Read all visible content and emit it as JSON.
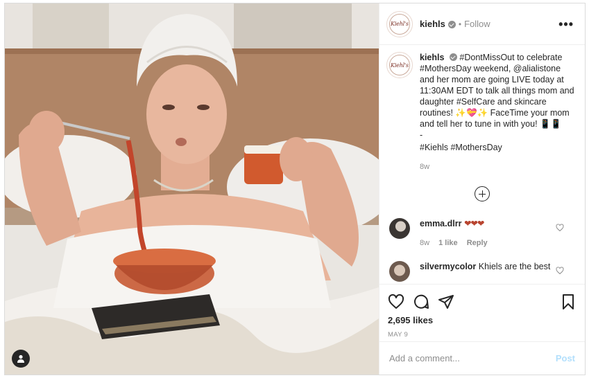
{
  "post": {
    "username": "kiehls",
    "follow_label": "Follow",
    "more_label": "•••",
    "logo_text": "Kiehl's",
    "caption": {
      "username": "kiehls",
      "text": "#DontMissOut to celebrate #MothersDay weekend, @alialistone and her mom are going LIVE today at 11:30AM EDT to talk all things mom and daughter #SelfCare and skincare routines! ✨💝✨ FaceTime your mom and tell her to tune in with you! 📱📱\n-",
      "hashtags": "#Kiehls #MothersDay",
      "age": "8w"
    },
    "comments": [
      {
        "username": "emma.dlrr",
        "text": "❤❤❤",
        "age": "8w",
        "likes": "1 like",
        "reply_label": "Reply"
      },
      {
        "username": "silvermycolor",
        "text": "Khiels are the best",
        "age": "",
        "likes": "",
        "reply_label": ""
      }
    ],
    "likes": "2,695 likes",
    "date": "MAY 9",
    "add_comment_placeholder": "Add a comment...",
    "post_label": "Post"
  },
  "icons": {
    "like": "heart-icon",
    "comment": "comment-bubble-icon",
    "share": "paper-plane-icon",
    "save": "bookmark-icon",
    "user_tag": "user-tag-icon",
    "load_more": "plus-circle-icon"
  },
  "colors": {
    "accent_brand": "#7a2d22",
    "muted_text": "#8e8e8e",
    "post_button": "#b2dffc",
    "hearts": "#b8442f"
  }
}
